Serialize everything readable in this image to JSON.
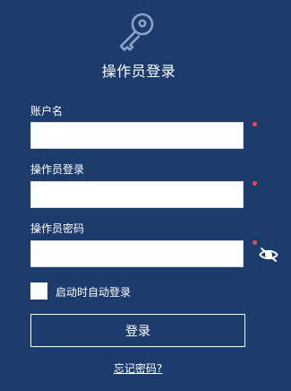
{
  "header": {
    "icon": "key-icon",
    "title": "操作员登录"
  },
  "form": {
    "account": {
      "label": "账户名",
      "value": "",
      "required": true
    },
    "operator": {
      "label": "操作员登录",
      "value": "",
      "required": true
    },
    "password": {
      "label": "操作员密码",
      "value": "",
      "required": true,
      "visibility_icon": "eye-slash-icon"
    },
    "auto_login": {
      "label": "启动时自动登录",
      "checked": false
    }
  },
  "actions": {
    "login_label": "登录",
    "forgot_label": "忘记密码?"
  },
  "colors": {
    "background": "#1d3c6e",
    "required_dot": "#e84b4b",
    "text": "#ffffff"
  }
}
